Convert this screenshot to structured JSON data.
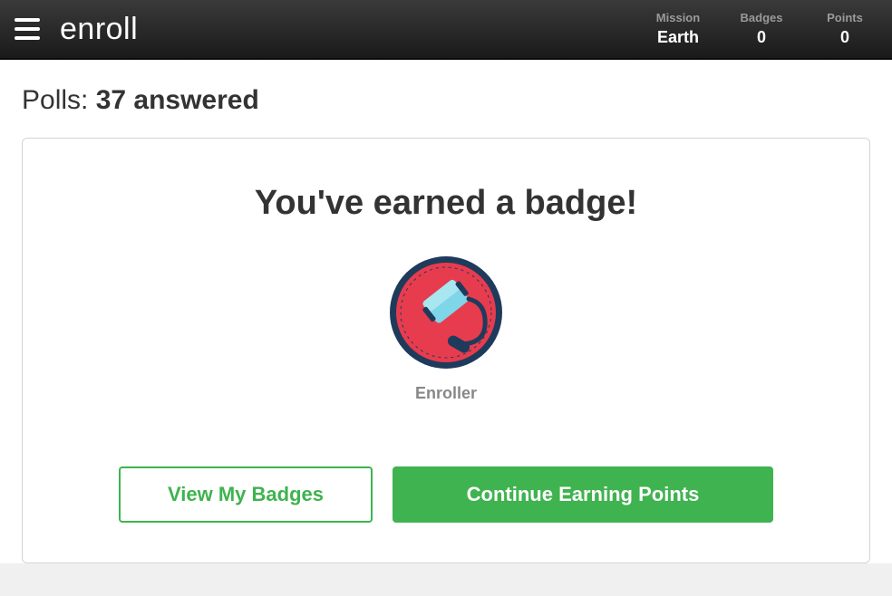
{
  "header": {
    "logo": "enroll",
    "stats": {
      "mission": {
        "label": "Mission",
        "value": "Earth"
      },
      "badges": {
        "label": "Badges",
        "value": "0"
      },
      "points": {
        "label": "Points",
        "value": "0"
      }
    }
  },
  "polls": {
    "prefix": "Polls: ",
    "count": "37 answered"
  },
  "card": {
    "title": "You've earned a badge!",
    "badge_name": "Enroller",
    "view_badges_label": "View My Badges",
    "continue_label": "Continue Earning Points"
  }
}
